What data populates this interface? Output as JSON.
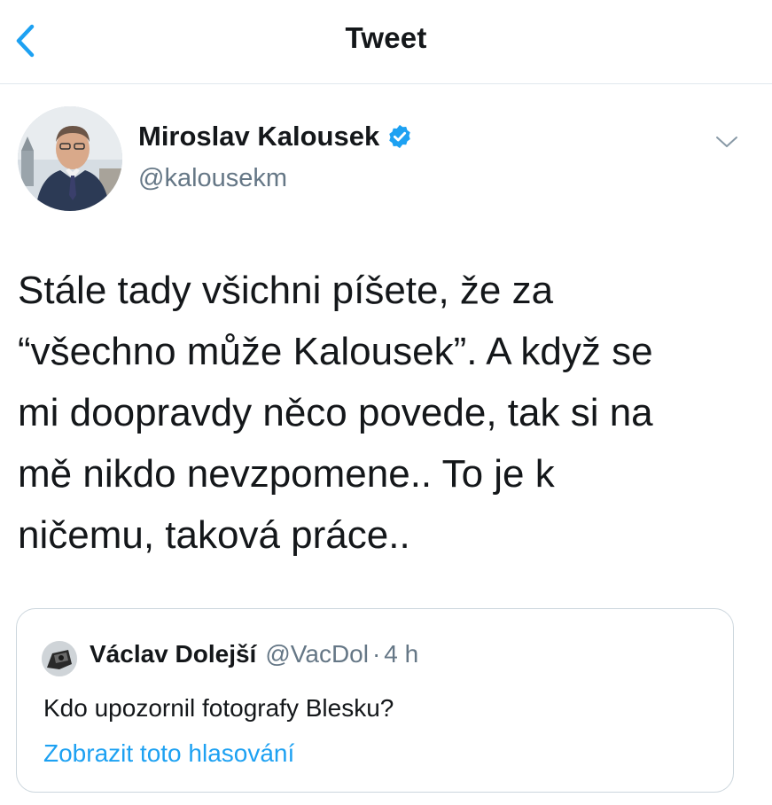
{
  "header": {
    "title": "Tweet",
    "back_icon": "chevron-left-icon"
  },
  "tweet": {
    "author": {
      "display_name": "Miroslav Kalousek",
      "handle": "@kalousekm",
      "verified": true
    },
    "text_lines": [
      "Stále tady všichni píšete, že za",
      "“všechno může Kalousek”. A když se",
      "mi doopravdy něco povede, tak si na",
      "mě nikdo nevzpomene.. To je k",
      "ničemu, taková práce.."
    ]
  },
  "quoted_tweet": {
    "display_name": "Václav Dolejší",
    "handle": "@VacDol",
    "separator": "·",
    "time": "4 h",
    "text": "Kdo upozornil fotografy Blesku?",
    "link_label": "Zobrazit toto hlasování"
  },
  "colors": {
    "accent": "#1da1f2",
    "text_primary": "#14171a",
    "text_secondary": "#657786",
    "border": "#ccd6dd"
  }
}
